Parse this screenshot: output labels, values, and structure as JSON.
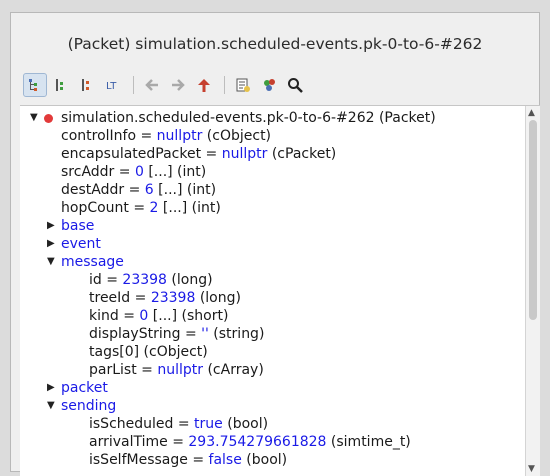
{
  "window_title": "(Packet) simulation.scheduled-events.pk-0-to-6-#262",
  "toolbar": [
    {
      "icon": "tree-view-icon",
      "active": true
    },
    {
      "icon": "children-view-icon"
    },
    {
      "icon": "grouped-view-icon"
    },
    {
      "icon": "flat-view-icon"
    },
    {
      "icon": "back-arrow-icon"
    },
    {
      "icon": "forward-arrow-icon"
    },
    {
      "icon": "up-arrow-icon"
    },
    {
      "icon": "copy-icon"
    },
    {
      "icon": "find-objects-icon"
    },
    {
      "icon": "search-icon"
    }
  ],
  "tree": {
    "root": {
      "label": "simulation.scheduled-events.pk-0-to-6-#262 (Packet)"
    },
    "fields": [
      {
        "name": "controlInfo",
        "value": "nullptr",
        "type": "(cObject)"
      },
      {
        "name": "encapsulatedPacket",
        "value": "nullptr",
        "type": "(cPacket)"
      },
      {
        "name": "srcAddr",
        "value": "0",
        "type": "[...]  (int)"
      },
      {
        "name": "destAddr",
        "value": "6",
        "type": "[...]  (int)"
      },
      {
        "name": "hopCount",
        "value": "2",
        "type": "[...]  (int)"
      }
    ],
    "group_base": "base",
    "group_event": "event",
    "group_message": "message",
    "message_fields": [
      {
        "name": "id",
        "value": "23398",
        "type": "(long)"
      },
      {
        "name": "treeId",
        "value": "23398",
        "type": "(long)"
      },
      {
        "name": "kind",
        "value": "0",
        "type": "[...]  (short)"
      },
      {
        "name": "displayString",
        "value": "''",
        "type": "(string)"
      },
      {
        "name": "tags[0] (cObject)",
        "value": null,
        "type": ""
      },
      {
        "name": "parList",
        "value": "nullptr",
        "type": "(cArray)"
      }
    ],
    "group_packet": "packet",
    "group_sending": "sending",
    "sending_fields": [
      {
        "name": "isScheduled",
        "value": "true",
        "type": "(bool)"
      },
      {
        "name": "arrivalTime",
        "value": "293.754279661828",
        "type": "(simtime_t)"
      },
      {
        "name": "isSelfMessage",
        "value": "false",
        "type": "(bool)"
      }
    ]
  },
  "colors": {
    "value": "#1a1ae6",
    "root_dot": "#e23a3a"
  }
}
